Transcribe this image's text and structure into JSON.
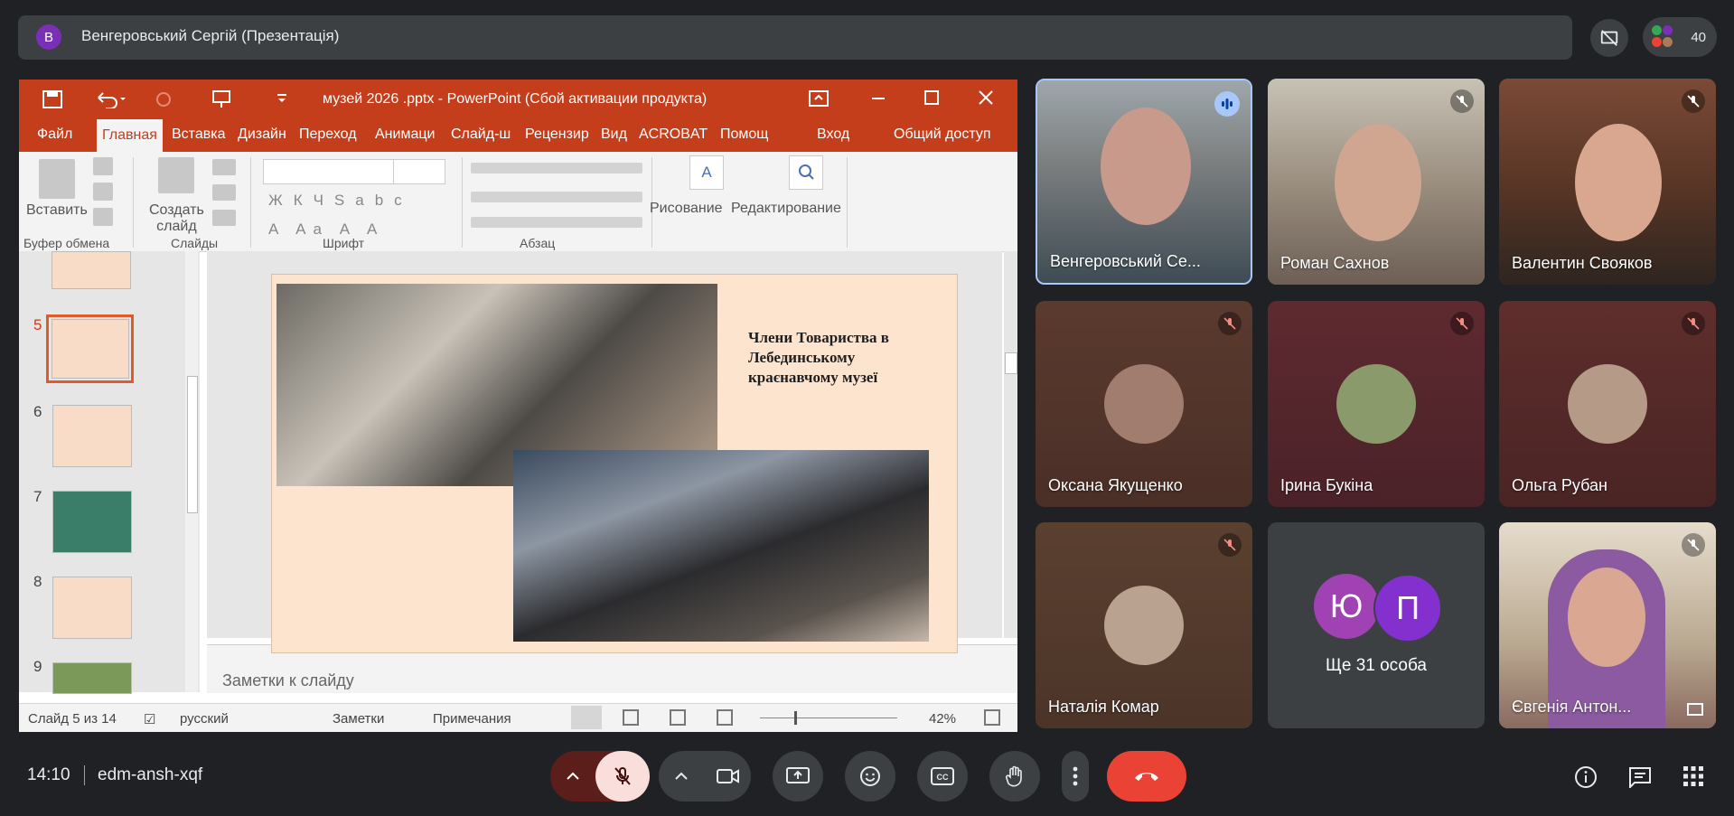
{
  "topbar": {
    "avatar_letter": "В",
    "presenter": "Венгеровський Сергій (Презентація)",
    "people_count": "40"
  },
  "ppt": {
    "title": "музей 2026 .pptx - PowerPoint (Сбой активации продукта)",
    "tabs": [
      "Файл",
      "Главная",
      "Вставка",
      "Дизайн",
      "Переход",
      "Анимаци",
      "Слайд-ш",
      "Рецензир",
      "Вид",
      "ACROBAT",
      "Помощ",
      "Вход",
      "Общий доступ"
    ],
    "ribbon": {
      "paste": "Вставить",
      "clipboard": "Буфер обмена",
      "new_slide_1": "Создать",
      "new_slide_2": "слайд",
      "slides": "Слайды",
      "font": "Шрифт",
      "paragraph": "Абзац",
      "drawing": "Рисование",
      "editing": "Редактирование"
    },
    "thumb_numbers": [
      "5",
      "6",
      "7",
      "8",
      "9"
    ],
    "slide_text": "Члени Товариства в Лебединському краєнавчому музеї",
    "notes_placeholder": "Заметки к слайду",
    "status": {
      "slide": "Слайд 5 из 14",
      "lang": "русский",
      "notes": "Заметки",
      "comments": "Примечания",
      "zoom": "42%"
    }
  },
  "tiles": [
    {
      "name": "Венгеровський Се...",
      "speaking": true
    },
    {
      "name": "Роман Сахнов"
    },
    {
      "name": "Валентин Свояков"
    },
    {
      "name": "Оксана Якущенко"
    },
    {
      "name": "Ірина Букіна"
    },
    {
      "name": "Ольга Рубан"
    },
    {
      "name": "Наталія Комар"
    },
    {
      "name": "Ще 31 особа",
      "letters": [
        "Ю",
        "П"
      ]
    },
    {
      "name": "Євгенія Антон..."
    }
  ],
  "bottom": {
    "time": "14:10",
    "code": "edm-ansh-xqf"
  },
  "colors": {
    "bg": "#202124",
    "ppt_red": "#c43e1c",
    "hangup": "#ea4335",
    "mic_off": "#f9dedc"
  }
}
